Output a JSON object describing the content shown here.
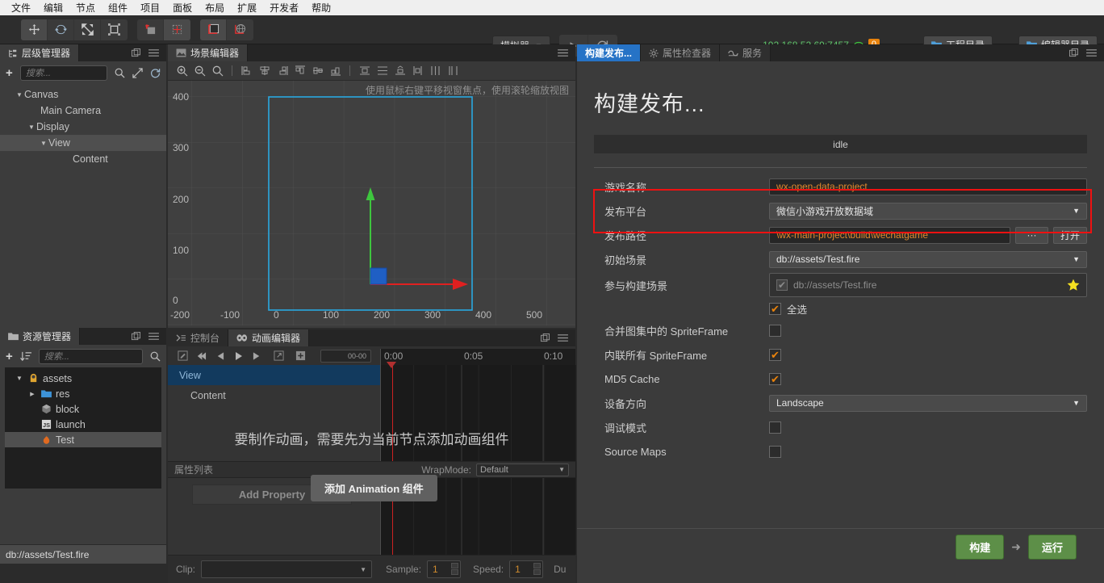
{
  "menubar": {
    "items": [
      "文件",
      "编辑",
      "节点",
      "组件",
      "项目",
      "面板",
      "布局",
      "扩展",
      "开发者",
      "帮助"
    ]
  },
  "toolbar": {
    "transform_tools": [
      "move-tool",
      "rotate-tool",
      "scale-tool",
      "rect-tool"
    ],
    "pivot_tools": [
      "pivot-tool",
      "anchor-tool"
    ],
    "coord_tools": [
      "local-coord-tool",
      "global-coord-tool"
    ],
    "simulator_label": "模拟器",
    "simulator_caret": "▼",
    "play_label": "play-icon",
    "refresh_label": "refresh-icon",
    "ip_address": "192.168.52.69:7457",
    "wifi_icon": "wifi-icon",
    "device_count": "0",
    "project_dir_label": "工程目录",
    "editor_dir_label": "编辑器目录"
  },
  "hierarchy": {
    "tab_label": "层级管理器",
    "add_label": "+",
    "search_placeholder": "搜索...",
    "nodes": [
      {
        "label": "Canvas",
        "depth": 0,
        "caret": "▼",
        "selected": false
      },
      {
        "label": "Main Camera",
        "depth": 1,
        "caret": "",
        "selected": false
      },
      {
        "label": "Display",
        "depth": 1,
        "caret": "▼",
        "selected": false
      },
      {
        "label": "View",
        "depth": 2,
        "caret": "▼",
        "selected": true
      },
      {
        "label": "Content",
        "depth": 3,
        "caret": "",
        "selected": false
      }
    ]
  },
  "assets": {
    "tab_label": "资源管理器",
    "add_label": "+",
    "search_placeholder": "搜索...",
    "items": [
      {
        "label": "assets",
        "depth": 0,
        "caret": "▼",
        "icon": "assets-folder-icon",
        "selected": false
      },
      {
        "label": "res",
        "depth": 1,
        "caret": "▶",
        "icon": "folder-icon",
        "selected": false
      },
      {
        "label": "block",
        "depth": 1,
        "caret": "",
        "icon": "prefab-icon",
        "selected": false
      },
      {
        "label": "launch",
        "depth": 1,
        "caret": "",
        "icon": "js-file-icon",
        "selected": false
      },
      {
        "label": "Test",
        "depth": 1,
        "caret": "",
        "icon": "scene-fire-icon",
        "selected": true
      }
    ]
  },
  "status_bar": {
    "path": "db://assets/Test.fire"
  },
  "scene": {
    "tab_label": "场景编辑器",
    "hint": "使用鼠标右键平移视窗焦点，使用滚轮缩放视图",
    "y_ticks": [
      "400",
      "300",
      "200",
      "100",
      "0"
    ],
    "x_ticks": [
      "-200",
      "-100",
      "0",
      "100",
      "200",
      "300",
      "400",
      "500"
    ],
    "gizmo": {
      "x_axis_color": "#e02020",
      "y_axis_color": "#3ec63e",
      "node_color": "#1f5fc4"
    },
    "frame_color": "#29a8e0"
  },
  "animation": {
    "console_tab_label": "控制台",
    "anim_tab_label": "动画编辑器",
    "frame_value": "00-00",
    "timeline_labels": [
      "0:00",
      "0:05",
      "0:10"
    ],
    "rows": [
      {
        "label": "View",
        "selected": true
      },
      {
        "label": "Content",
        "selected": false
      }
    ],
    "message": "要制作动画，需要先为当前节点添加动画组件",
    "property_list_label": "属性列表",
    "wrapmode_label": "WrapMode:",
    "wrapmode_value": "Default",
    "add_property_label": "Add Property",
    "add_animation_label": "添加 Animation 组件",
    "clip_label": "Clip:",
    "clip_value": "",
    "sample_label": "Sample:",
    "sample_value": "1",
    "speed_label": "Speed:",
    "speed_value": "1",
    "duration_label": "Du"
  },
  "build": {
    "tabs": [
      {
        "label": "构建发布...",
        "icon": "",
        "active": true
      },
      {
        "label": "属性检查器",
        "icon": "gear-icon",
        "active": false
      },
      {
        "label": "服务",
        "icon": "service-icon",
        "active": false
      }
    ],
    "title": "构建发布...",
    "status": "idle",
    "fields": {
      "game_name_label": "游戏名称",
      "game_name_value": "wx-open-data-project",
      "platform_label": "发布平台",
      "platform_value": "微信小游戏开放数据域",
      "path_label": "发布路径",
      "path_value": "\\wx-main-project\\build\\wechatgame",
      "browse_label": "···",
      "open_label": "打开",
      "start_scene_label": "初始场景",
      "start_scene_value": "db://assets/Test.fire",
      "build_scenes_label": "参与构建场景",
      "build_scenes_item": "db://assets/Test.fire",
      "select_all_label": "全选",
      "select_all_checked": true,
      "merge_spriteframe_label": "合并图集中的 SpriteFrame",
      "merge_spriteframe_checked": false,
      "inline_spriteframe_label": "内联所有 SpriteFrame",
      "inline_spriteframe_checked": true,
      "md5_cache_label": "MD5 Cache",
      "md5_cache_checked": true,
      "orientation_label": "设备方向",
      "orientation_value": "Landscape",
      "debug_label": "调试模式",
      "debug_checked": false,
      "source_maps_label": "Source Maps",
      "source_maps_checked": false
    },
    "footer": {
      "build_label": "构建",
      "arrow": "➜",
      "run_label": "运行"
    },
    "highlight_color": "#ee1111"
  },
  "colors": {
    "accent_orange": "#e0892e",
    "accent_blue": "#2673c6",
    "green_button": "#5d8f48",
    "panel_bg": "#3c3c3c",
    "toolbar_bg": "#2d2d2d"
  }
}
